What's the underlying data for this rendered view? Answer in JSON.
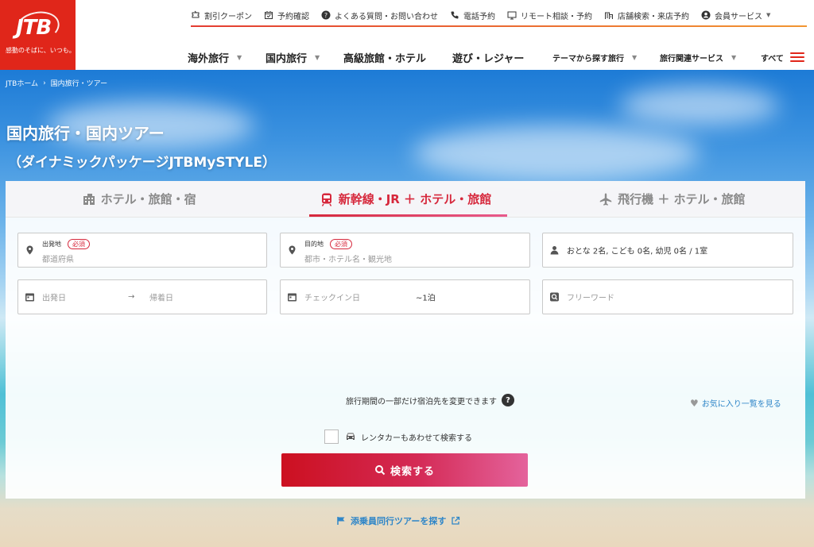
{
  "logo": {
    "text": "JTB",
    "tagline": "感動のそばに、いつも。"
  },
  "util_nav": [
    {
      "label": "割引クーポン",
      "icon": "coupon-icon"
    },
    {
      "label": "予約確認",
      "icon": "calendar-check-icon"
    },
    {
      "label": "よくある質問・お問い合わせ",
      "icon": "help-icon"
    },
    {
      "label": "電話予約",
      "icon": "phone-icon"
    },
    {
      "label": "リモート相談・予約",
      "icon": "monitor-icon"
    },
    {
      "label": "店舗検索・来店予約",
      "icon": "store-icon"
    },
    {
      "label": "会員サービス",
      "icon": "user-circle-icon"
    }
  ],
  "main_nav": [
    {
      "label": "海外旅行"
    },
    {
      "label": "国内旅行"
    },
    {
      "label": "高級旅館・ホテル"
    },
    {
      "label": "遊び・レジャー"
    },
    {
      "label": "テーマから探す旅行"
    },
    {
      "label": "旅行関連サービス"
    },
    {
      "label": "すべて"
    }
  ],
  "breadcrumb": {
    "home": "JTBホーム",
    "current": "国内旅行・ツアー"
  },
  "page": {
    "title": "国内旅行・国内ツアー",
    "subtitle": "（ダイナミックパッケージJTBMySTYLE）"
  },
  "tabs": [
    {
      "label": "ホテル・旅館・宿",
      "icon": "hotel-icon",
      "active": false
    },
    {
      "label": "新幹線・JR ＋ ホテル・旅館",
      "icon": "train-icon",
      "active": true
    },
    {
      "label": "飛行機 ＋ ホテル・旅館",
      "icon": "airplane-icon",
      "active": false
    }
  ],
  "form": {
    "departure": {
      "label": "出発地",
      "required": "必須",
      "placeholder": "都道府県"
    },
    "destination": {
      "label": "目的地",
      "required": "必須",
      "placeholder": "都市・ホテル名・観光地"
    },
    "guests": {
      "value": "おとな 2名, こども 0名, 幼児 0名 / 1室"
    },
    "depart_date": {
      "placeholder": "出発日"
    },
    "return_date": {
      "placeholder": "帰着日"
    },
    "checkin": {
      "placeholder": "チェックイン日",
      "nights": "~1泊"
    },
    "freeword": {
      "placeholder": "フリーワード"
    },
    "note": "旅行期間の一部だけ宿泊先を変更できます",
    "favorites": "お気に入り一覧を見る",
    "rental_car": "レンタカーもあわせて検索する",
    "search_button": "検索する",
    "escort_tour": "添乗員同行ツアーを探す"
  },
  "colors": {
    "brand_red": "#e0261a",
    "accent": "#d6283c",
    "link": "#2f86c8"
  }
}
